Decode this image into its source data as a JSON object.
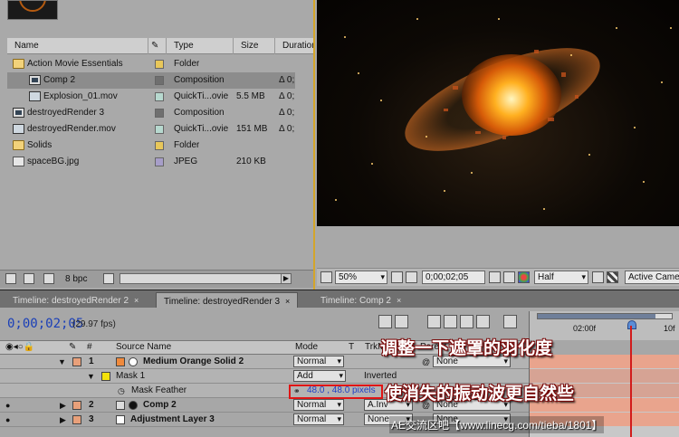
{
  "project": {
    "columns": [
      "Name",
      "Type",
      "Size",
      "Duration"
    ],
    "items": [
      {
        "name": "Action Movie Essentials",
        "type": "Folder",
        "size": "",
        "duration": "",
        "label_color": "#e8c75a",
        "icon": "folder-icon",
        "selected": false,
        "indent": 0
      },
      {
        "name": "Comp 2",
        "type": "Composition",
        "size": "",
        "duration": "Δ 0;",
        "label_color": "#6f6f6f",
        "icon": "composition-icon",
        "selected": true,
        "indent": 1
      },
      {
        "name": "Explosion_01.mov",
        "type": "QuickTi...ovie",
        "size": "5.5 MB",
        "duration": "Δ 0;",
        "label_color": "#b7d9cf",
        "icon": "movie-icon",
        "selected": false,
        "indent": 1
      },
      {
        "name": "destroyedRender 3",
        "type": "Composition",
        "size": "",
        "duration": "Δ 0;",
        "label_color": "#6f6f6f",
        "icon": "composition-icon",
        "selected": false,
        "indent": 0
      },
      {
        "name": "destroyedRender.mov",
        "type": "QuickTi...ovie",
        "size": "151 MB",
        "duration": "Δ 0;",
        "label_color": "#b7d9cf",
        "icon": "movie-icon",
        "selected": false,
        "indent": 0
      },
      {
        "name": "Solids",
        "type": "Folder",
        "size": "",
        "duration": "",
        "label_color": "#e8c75a",
        "icon": "folder-icon",
        "selected": false,
        "indent": 0
      },
      {
        "name": "spaceBG.jpg",
        "type": "JPEG",
        "size": "210 KB",
        "duration": "",
        "label_color": "#a79ec9",
        "icon": "image-icon",
        "selected": false,
        "indent": 0
      }
    ],
    "bit_depth": "8 bpc"
  },
  "viewer": {
    "zoom": "50%",
    "timecode": "0;00;02;05",
    "resolution": "Half",
    "camera": "Active Came"
  },
  "timeline": {
    "tabs": [
      {
        "label": "Timeline: destroyedRender 2",
        "active": false
      },
      {
        "label": "Timeline: destroyedRender 3",
        "active": true
      },
      {
        "label": "Timeline: Comp 2",
        "active": false
      }
    ],
    "timecode": "0;00;02;05",
    "fps": "(29.97 fps)",
    "ruler_labels": [
      "02:00f",
      "10f"
    ],
    "columns": {
      "source_name": "Source Name",
      "mode": "Mode",
      "t": "T",
      "trkmat": "TrkMat",
      "parent": "Parent"
    },
    "layers": [
      {
        "num": "1",
        "name": "Medium Orange Solid 2",
        "mode": "Normal",
        "trkmat": "",
        "parent": "None",
        "label_color": "#e8a07a"
      },
      {
        "num": "2",
        "name": "Comp 2",
        "mode": "Normal",
        "trkmat": "A.Inv",
        "parent": "None",
        "label_color": "#e8a07a"
      },
      {
        "num": "3",
        "name": "Adjustment Layer 3",
        "mode": "Normal",
        "trkmat": "None",
        "parent": "None",
        "label_color": "#e8a07a"
      }
    ],
    "mask": {
      "name": "Mask 1",
      "mode": "Add",
      "inverted_label": "Inverted",
      "feather_label": "Mask Feather",
      "feather_value": "48.0 , 48.0 pixels"
    }
  },
  "annotations": {
    "line1": "调整一下遮罩的羽化度",
    "line2": "使消失的振动波更自然些",
    "watermark": "AE交流区吧【www.linecg.com/tieba/1801】"
  }
}
